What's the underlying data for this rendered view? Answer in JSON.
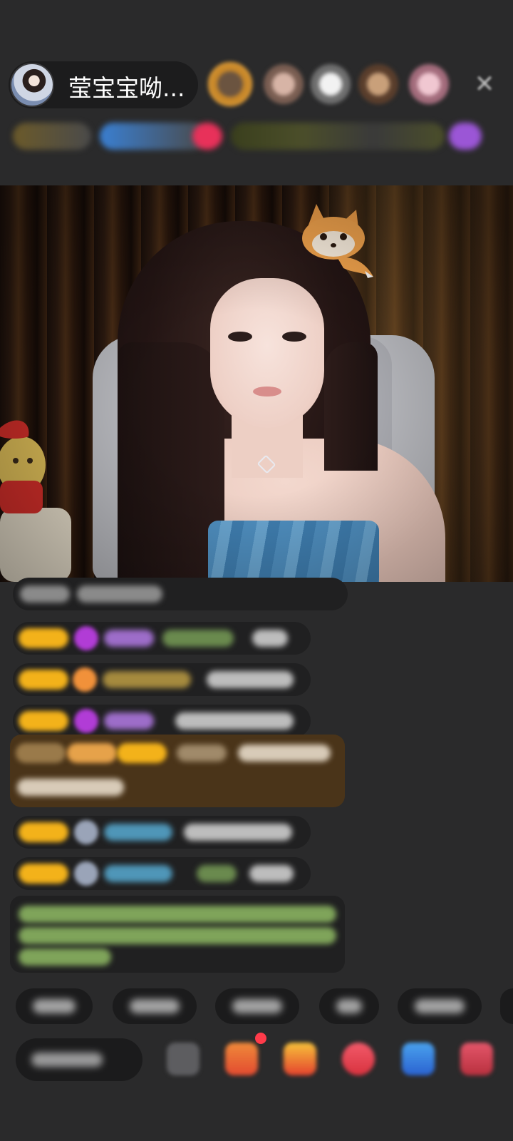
{
  "header": {
    "host_name": "莹宝宝呦...",
    "close_icon": "close-icon"
  },
  "colors": {
    "background": "#2a2a2b",
    "chat_highlight": "#4a3419",
    "badge_gold": "#f3b21a",
    "notification_red": "#ff3b4a"
  },
  "video": {
    "sticker": "fox-sticker"
  },
  "bottom": {
    "icons": [
      "gift-box-icon",
      "gift-bag-icon",
      "heart-gift-icon",
      "game-controller-icon",
      "treasure-box-icon"
    ]
  }
}
